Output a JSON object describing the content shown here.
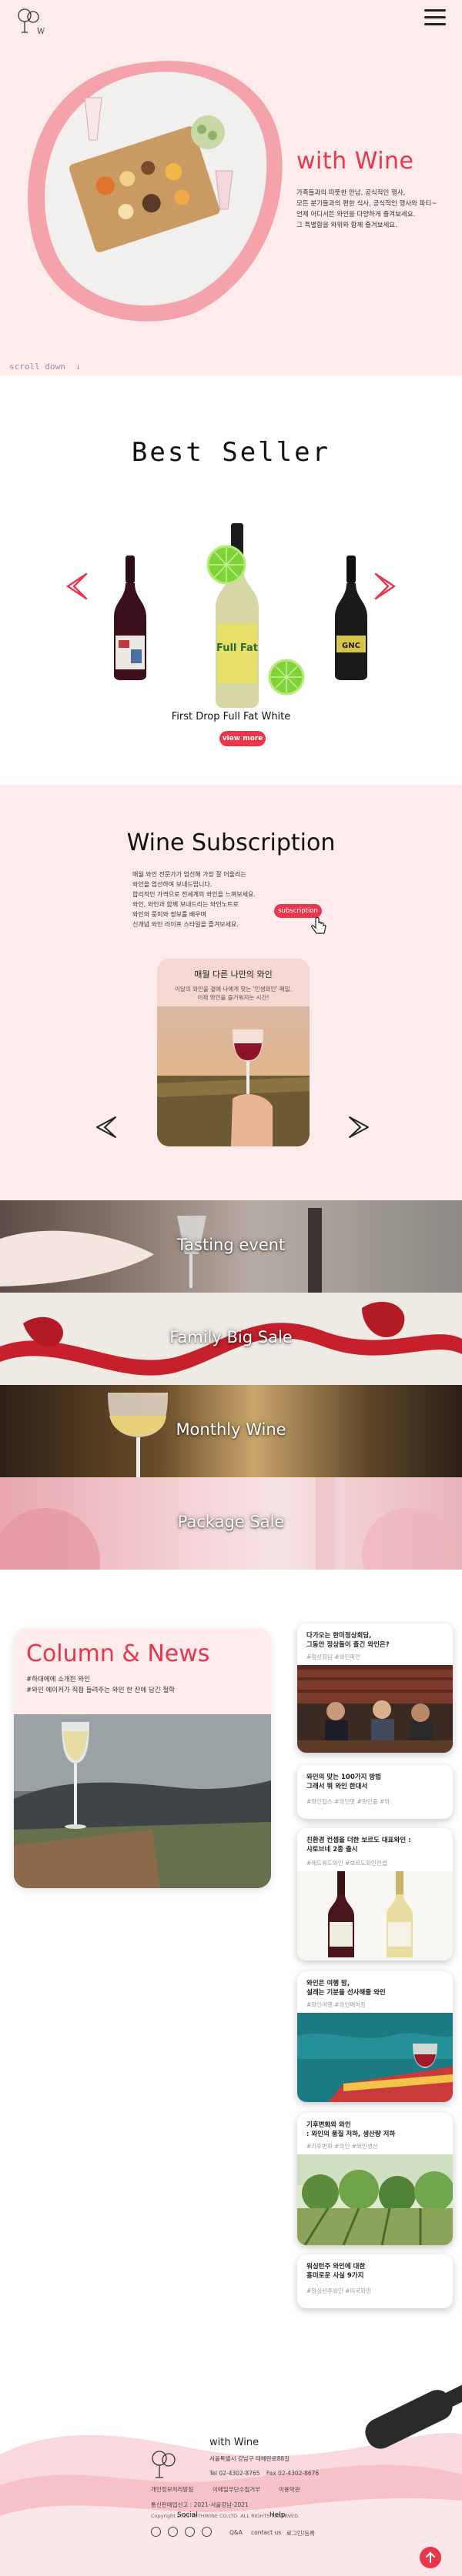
{
  "header": {
    "logo_text": "W",
    "menu_icon": "hamburger-icon"
  },
  "hero": {
    "title": "with Wine",
    "description": "가족들과의 따뜻한 만남, 공식적인 행사,\n모든 분기들과의 편한 식사, 공식적인 행사와 파티~\n언제 어디서든 와인을 다양하게 즐겨보세요.\n그 특별함을 와위와 함께 즐겨보세요.",
    "scroll_label": "scroll down"
  },
  "best_seller": {
    "title": "Best Seller",
    "caption": "First Drop Full Fat White",
    "button": "view more",
    "bottle_labels": [
      "Full Fat",
      "GNC"
    ]
  },
  "subscription": {
    "title": "Wine Subscription",
    "description": "매월 와인 전문가가 엄선해 가장 잘 어울리는\n와인을 엄선하여 보내드립니다.\n합리적인 가격으로 전세계의 와인을 느껴보세요.\n와인, 와인과 함께 보내드리는 와인노트로\n와인의 풍미와 정보를 배우며\n신개념 와인 라이프 스타일을 즐겨보세요.",
    "button": "subscription",
    "card_title": "매월 다른 나만의 와인",
    "card_desc": "이달의 와인을 곁에 나에게 맞는 '인생와인' 패밀,\n이제 와인을 즐거워지는 시간!"
  },
  "banners": [
    {
      "label": "Tasting event"
    },
    {
      "label": "Family Big Sale"
    },
    {
      "label": "Monthly Wine"
    },
    {
      "label": "Package Sale"
    }
  ],
  "column": {
    "title": "Column & News",
    "description": "#하대에에 소개된 와인\n#와인 에이커가 직접 들려주는 와인 한 잔에 담긴 철학",
    "news": [
      {
        "title": "다가오는 한미정상회담,\n그동안 정상들이 즐긴 와인은?",
        "tags": "#정상회담   #와인파인"
      },
      {
        "title": "와인의 맞는 100가지 방법\n그래서 뭐 와인 한대서",
        "tags": "#와인팁스   #와인맛   #와인즐   #와"
      },
      {
        "title": "친환경 컨셉을 더한 보르도 대표와인 :\n샤토브네 2종 출시",
        "tags": "#에드워드와인   #보르도와인컨셉"
      },
      {
        "title": "와인은 여행 밤,\n설레는 기분을 선사해줄 와인",
        "tags": "#와인여행   #와인페어링"
      },
      {
        "title": "기후변화와 와인\n: 와인의 품질 저하, 생산량 저하",
        "tags": "#기후변화   #와인   #와인생산"
      },
      {
        "title": "워싱턴주 와인에 대한\n흥미로운 사실 9가지",
        "tags": "#와싱턴주와인   #미국와인"
      }
    ]
  },
  "footer": {
    "brand": "with Wine",
    "address": "서울특별시 강남구 테헤란로88길",
    "phone": "Tel 02-4302-8765",
    "fax": "Fax 02-4302-8676",
    "links": [
      "개인정보처리방침",
      "이메일무단수집거부",
      "이용약관"
    ],
    "license": "통신판매업신고 : 2021-서울강남-2021",
    "copyright": "Copyright 2021 WITHWINE CO.LTD. ALL RIGHTS RESERVED.",
    "social_title": "Social",
    "help_title": "Help",
    "help_links": [
      "Q&A",
      "contact us",
      "로그인/등록"
    ],
    "social_icons": [
      "facebook-icon",
      "twitter-icon",
      "instagram-icon",
      "youtube-icon"
    ]
  },
  "colors": {
    "accent": "#e8364b",
    "pink_bg": "#fdeceb",
    "wave": "#f4b8bf"
  }
}
